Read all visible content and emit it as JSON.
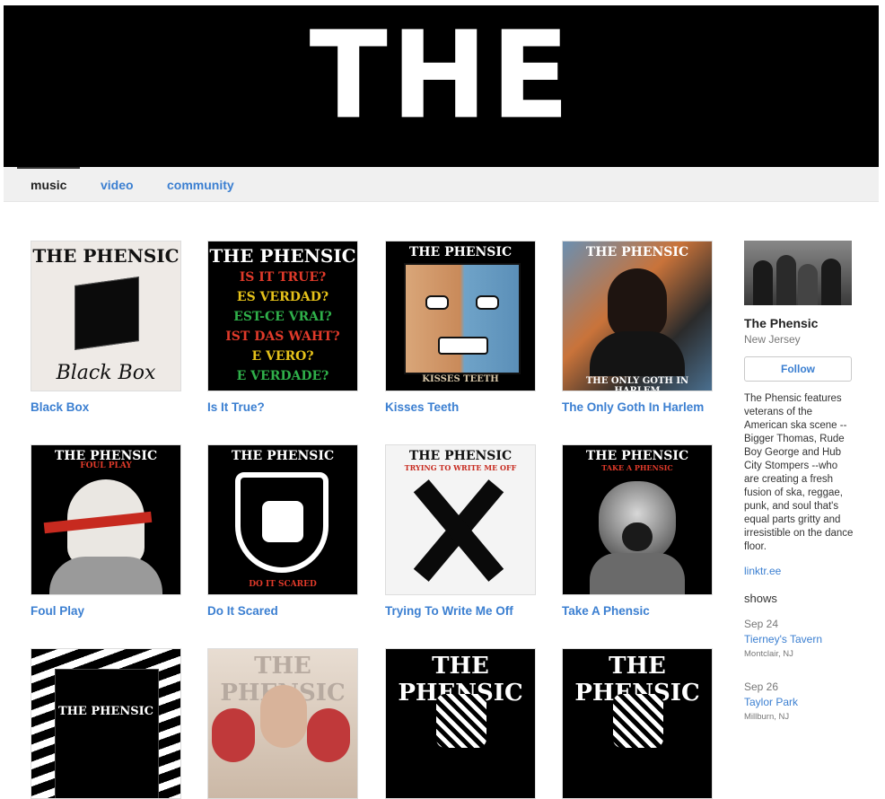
{
  "banner": {
    "title": "THE PHENSIC"
  },
  "nav": {
    "tabs": [
      {
        "label": "music"
      },
      {
        "label": "video"
      },
      {
        "label": "community"
      }
    ]
  },
  "albums": [
    {
      "title": "Black Box",
      "cover_title": "THE PHENSIC",
      "cover_text": "Black Box",
      "bg": "#eeeae6"
    },
    {
      "title": "Is It True?",
      "cover_title": "THE PHENSIC",
      "lines": [
        "IS IT TRUE?",
        "ES VERDAD?",
        "EST-CE VRAI?",
        "IST DAS WAHT?",
        "E VERO?",
        "E VERDADE?"
      ],
      "bg": "#000000"
    },
    {
      "title": "Kisses Teeth",
      "cover_title": "THE PHENSIC",
      "cover_text": "KISSES TEETH",
      "bg": "#000000"
    },
    {
      "title": "The Only Goth In Harlem",
      "cover_title": "THE PHENSIC",
      "cover_text": "THE ONLY GOTH IN HARLEM",
      "bg": "#2c2c2c"
    },
    {
      "title": "Foul Play",
      "cover_title": "THE PHENSIC",
      "cover_text": "FOUL PLAY",
      "bg": "#000000"
    },
    {
      "title": "Do It Scared",
      "cover_title": "THE PHENSIC",
      "cover_text": "DO IT SCARED",
      "bg": "#000000"
    },
    {
      "title": "Trying To Write Me Off",
      "cover_title": "THE PHENSIC",
      "cover_text": "TRYING TO WRITE ME OFF",
      "bg": "#f4f4f4"
    },
    {
      "title": "Take A Phensic",
      "cover_title": "THE PHENSIC",
      "cover_text": "TAKE A PHENSIC",
      "bg": "#000000"
    },
    {
      "title": "",
      "cover_title": "THE PHENSIC",
      "cover_text": "",
      "bg": "#000000"
    },
    {
      "title": "",
      "cover_title": "THE PHENSIC",
      "cover_text": "",
      "bg": "#d9cfc4"
    },
    {
      "title": "",
      "cover_title": "THE PHENSIC",
      "cover_text": "",
      "bg": "#000000"
    },
    {
      "title": "",
      "cover_title": "THE PHENSIC",
      "cover_text": "",
      "bg": "#000000"
    }
  ],
  "sidebar": {
    "name": "The Phensic",
    "location": "New Jersey",
    "follow_label": "Follow",
    "bio": "The Phensic features veterans of the American ska scene -- Bigger Thomas, Rude Boy George and Hub City Stompers --who are creating a fresh fusion of ska, reggae, punk, and soul that's equal parts gritty and irresistible on the dance floor.",
    "link": "linktr.ee",
    "shows_heading": "shows",
    "shows": [
      {
        "date": "Sep 24",
        "venue": "Tierney's Tavern",
        "city": "Montclair, NJ"
      },
      {
        "date": "Sep 26",
        "venue": "Taylor Park",
        "city": "Millburn, NJ"
      }
    ]
  },
  "colors": {
    "link": "#3b7fd1",
    "nav_bg": "#f0f0f0"
  }
}
